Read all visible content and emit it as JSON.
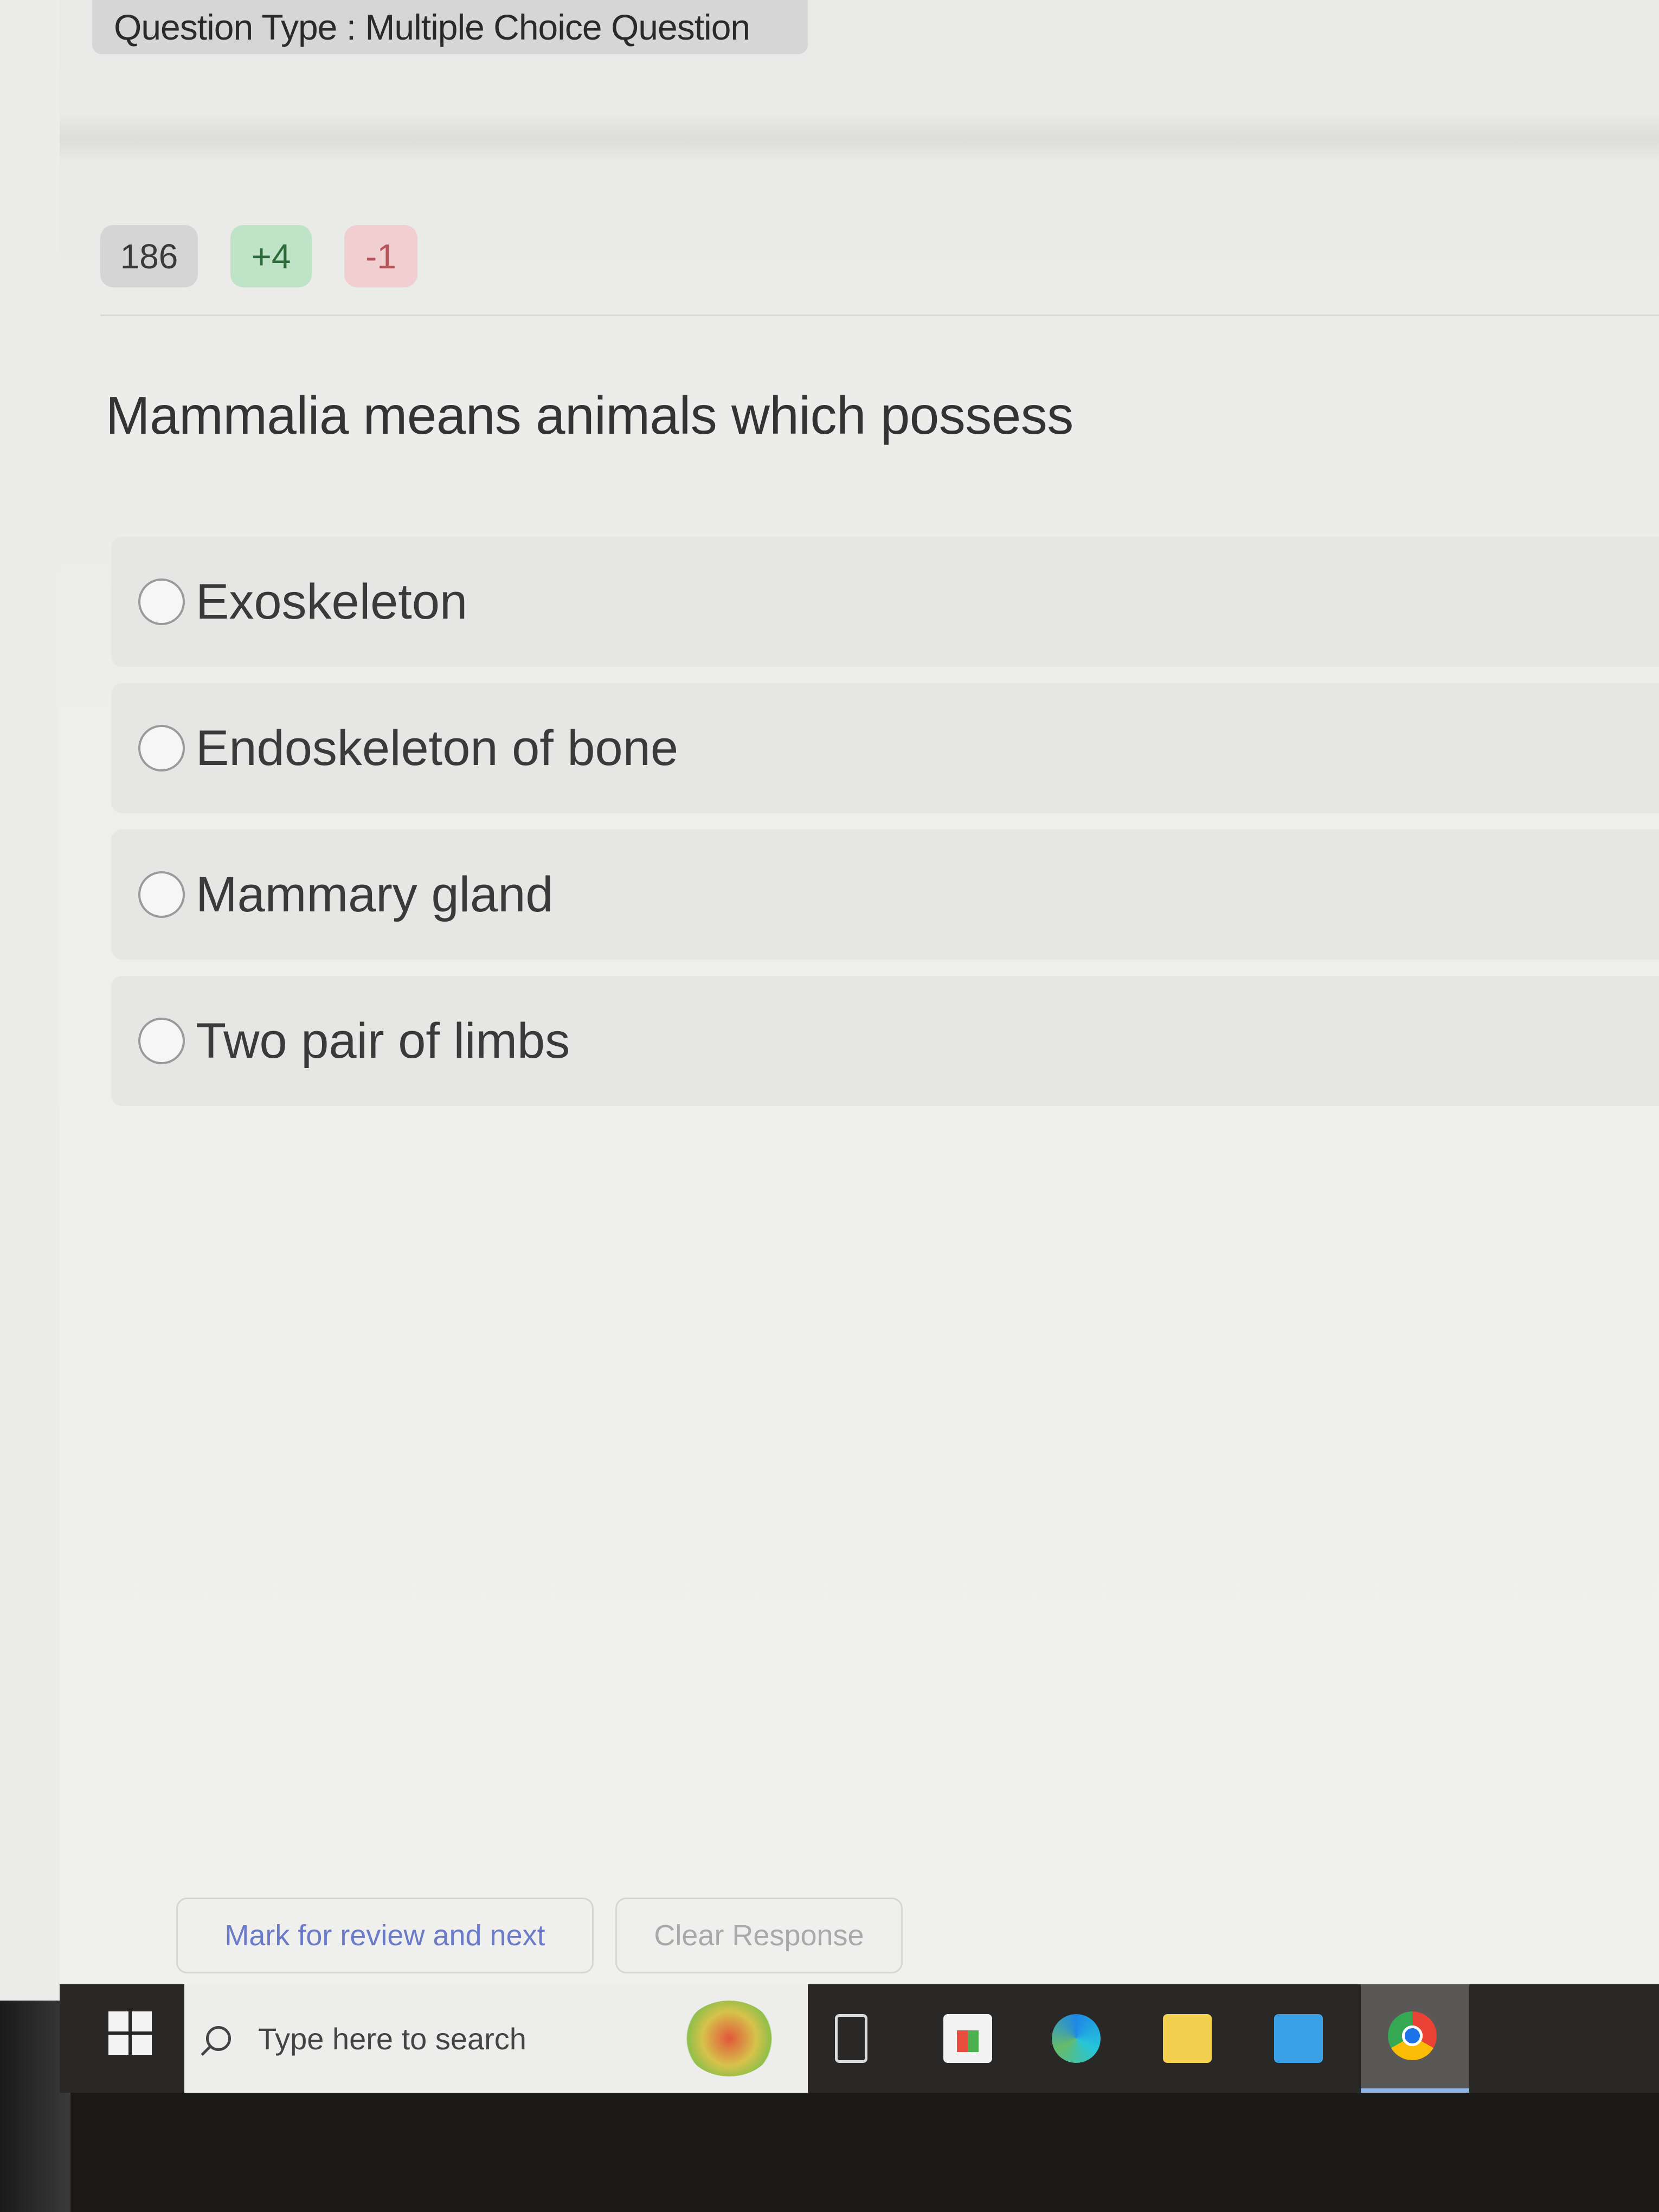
{
  "exam": {
    "question_type_label": "Question Type : Multiple Choice Question",
    "question_number": "186",
    "marks_positive": "+4",
    "marks_negative": "-1",
    "question_text": "Mammalia means animals which possess",
    "options": [
      {
        "label": "Exoskeleton",
        "selected": false
      },
      {
        "label": "Endoskeleton of bone",
        "selected": false
      },
      {
        "label": "Mammary gland",
        "selected": false
      },
      {
        "label": "Two pair of limbs",
        "selected": false
      }
    ],
    "actions": {
      "mark_review_label": "Mark for review and next",
      "clear_response_label": "Clear Response"
    },
    "colors": {
      "positive_badge": "#bfe3c6",
      "negative_badge": "#f1cfd1",
      "mark_review_text": "#6b7bc9"
    }
  },
  "taskbar": {
    "search_placeholder": "Type here to search",
    "apps": [
      "windows-start",
      "search",
      "task-view",
      "microsoft-store",
      "edge",
      "file-explorer",
      "mail",
      "chrome"
    ]
  }
}
